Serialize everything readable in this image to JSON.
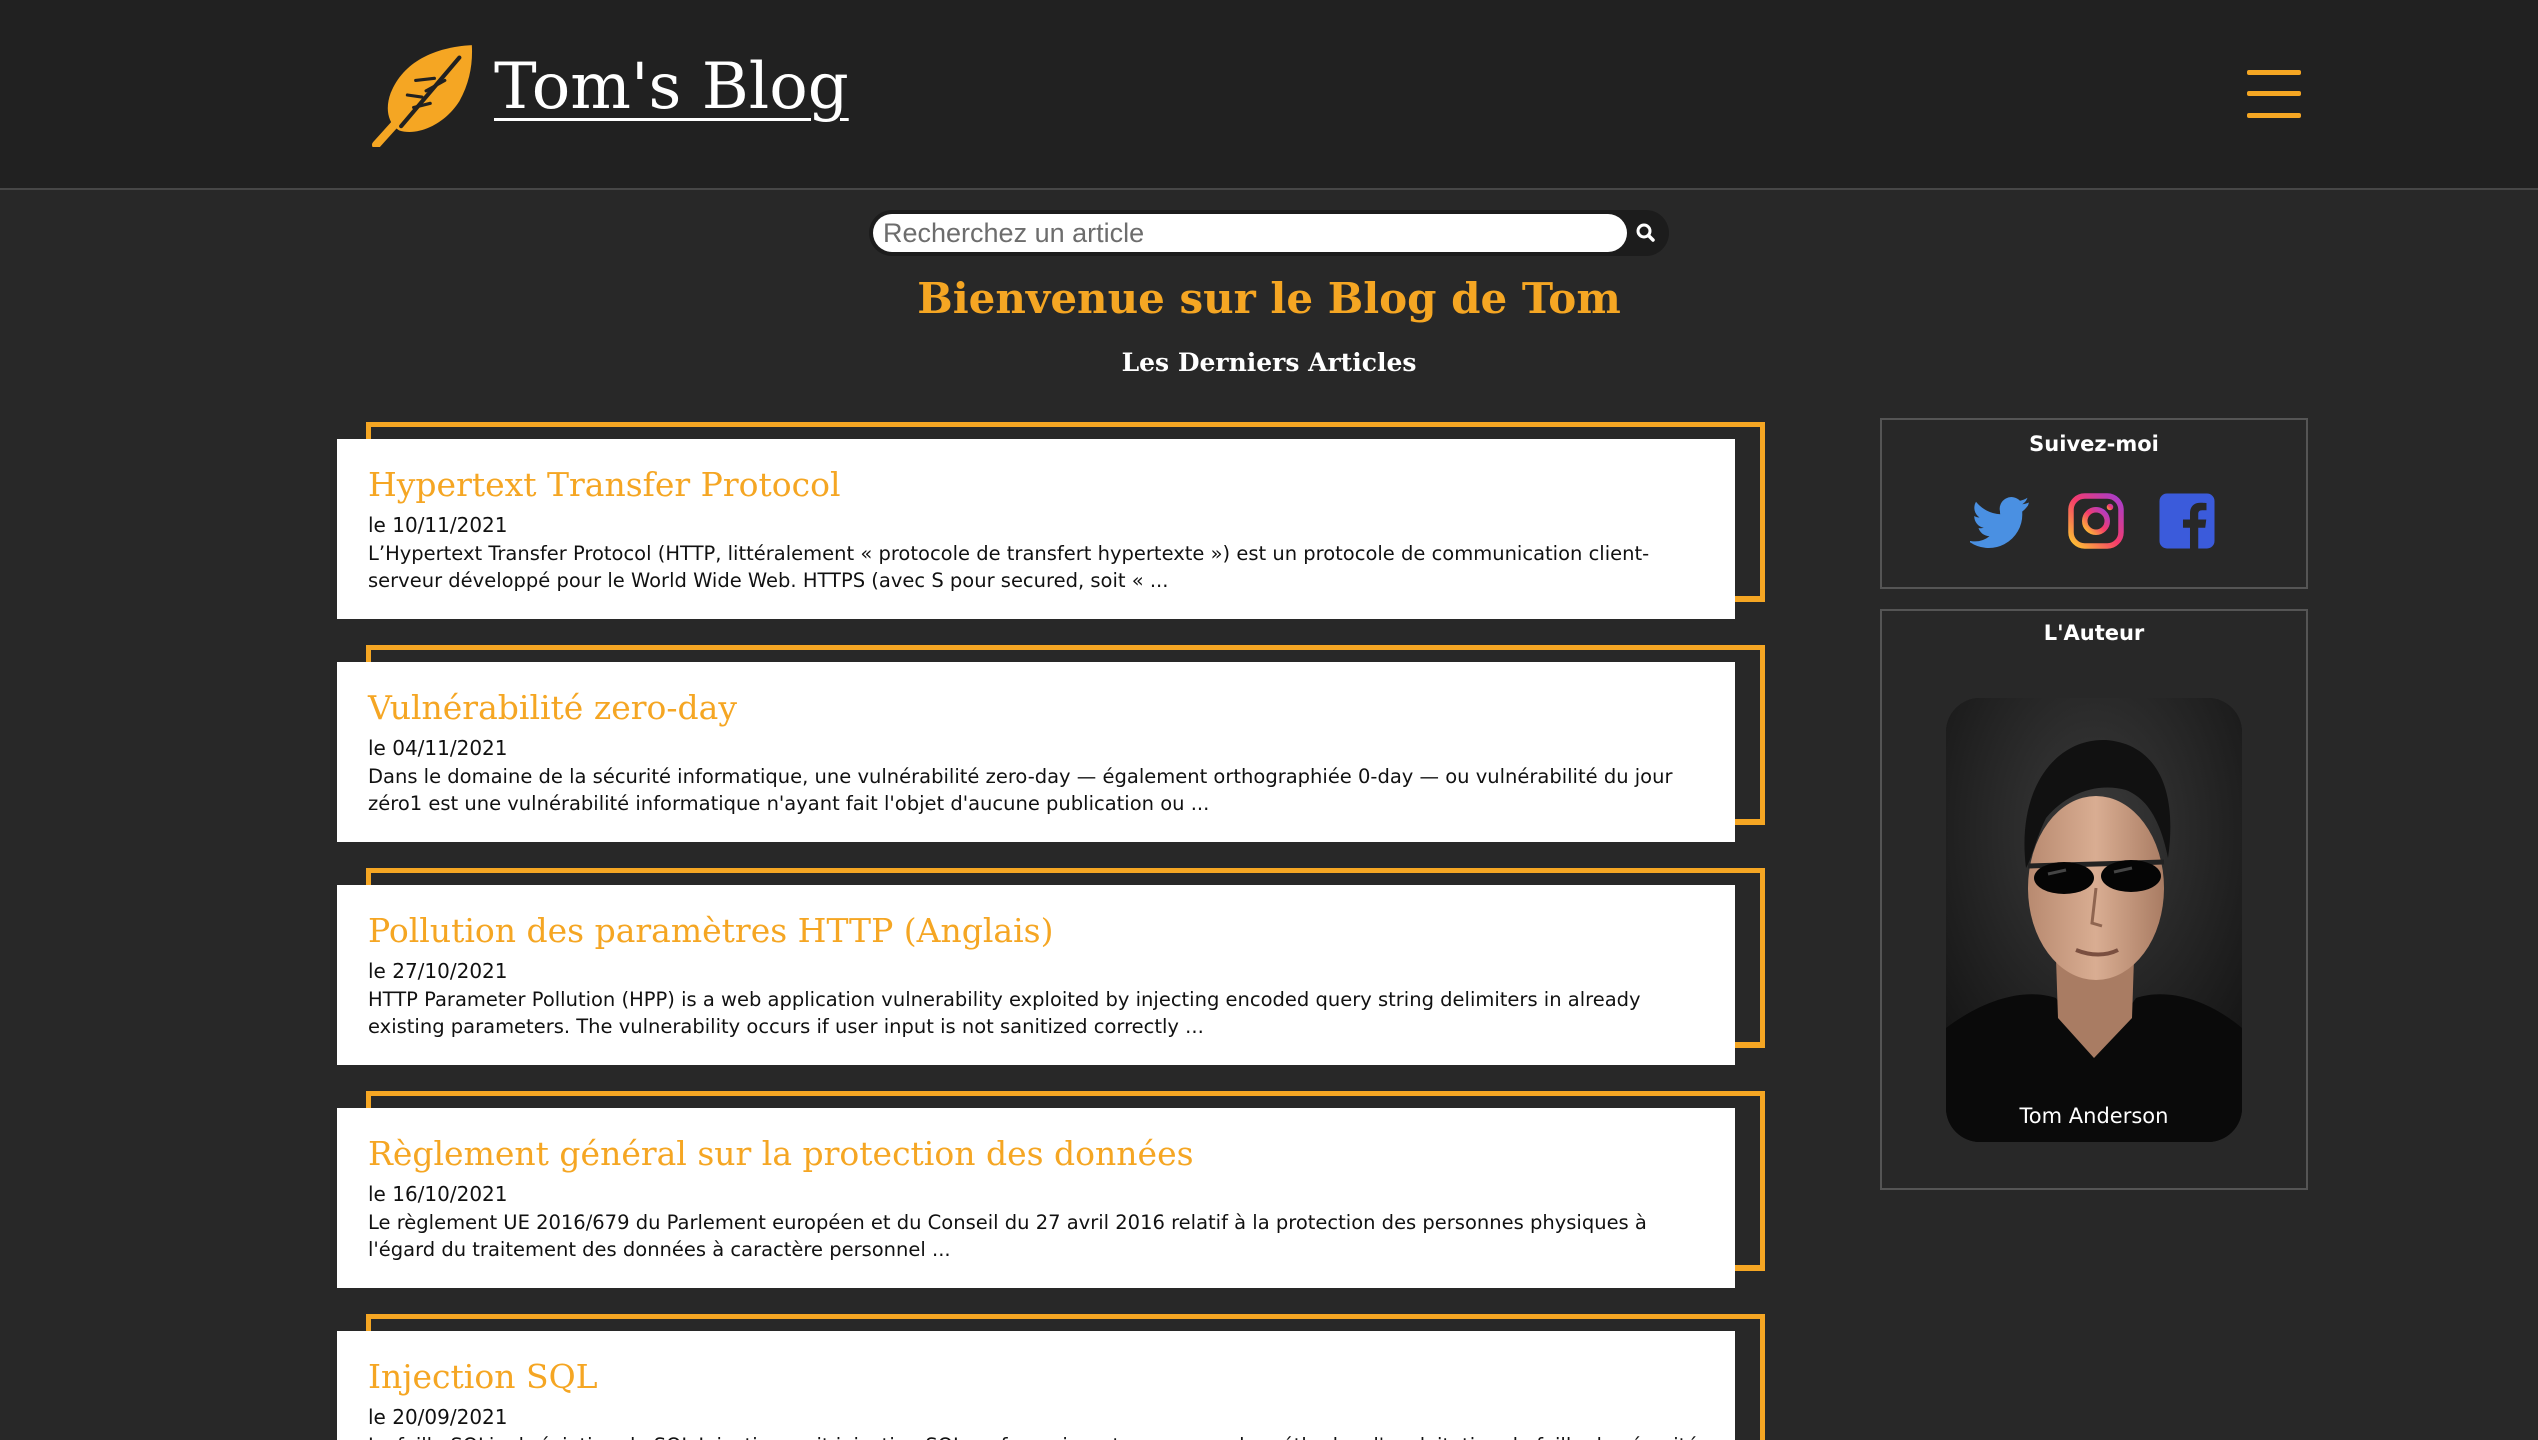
{
  "header": {
    "site_title": "Tom's Blog",
    "logo_icon": "feather-icon",
    "menu_icon": "hamburger-menu-icon",
    "accent_color": "#f5a623"
  },
  "search": {
    "placeholder": "Recherchez un article",
    "value": "",
    "button_icon": "search-icon"
  },
  "main": {
    "welcome": "Bienvenue sur le Blog de Tom",
    "latest_heading": "Les Derniers Articles",
    "articles": [
      {
        "title": "Hypertext Transfer Protocol",
        "date": "le 10/11/2021",
        "excerpt": "L’Hypertext Transfer Protocol (HTTP, littéralement « protocole de transfert hypertexte ») est un protocole de communication client-serveur développé pour le World Wide Web. HTTPS (avec S pour secured, soit « ..."
      },
      {
        "title": "Vulnérabilité zero-day",
        "date": "le 04/11/2021",
        "excerpt": "Dans le domaine de la sécurité informatique, une vulnérabilité zero-day — également orthographiée 0-day — ou vulnérabilité du jour zéro1 est une vulnérabilité informatique n'ayant fait l'objet d'aucune publication ou ..."
      },
      {
        "title": "Pollution des paramètres HTTP (Anglais)",
        "date": "le 27/10/2021",
        "excerpt": "HTTP Parameter Pollution (HPP) is a web application vulnerability exploited by injecting encoded query string delimiters in already existing parameters. The vulnerability occurs if user input is not sanitized correctly ..."
      },
      {
        "title": "Règlement général sur la protection des données",
        "date": "le 16/10/2021",
        "excerpt": "Le règlement UE 2016/679 du Parlement européen et du Conseil du 27 avril 2016 relatif à la protection des personnes physiques à l'égard du traitement des données à caractère personnel ..."
      },
      {
        "title": "Injection SQL",
        "date": "le 20/09/2021",
        "excerpt": "La faille SQLi, abréviation de SQL Injection, soit injection SQL en français, est un groupe de méthodes d'exploitation de faille de sécurité d'une"
      }
    ]
  },
  "sidebar": {
    "follow_title": "Suivez-moi",
    "social_icons": [
      "twitter-icon",
      "instagram-icon",
      "facebook-icon"
    ],
    "author_title": "L'Auteur",
    "author_name": "Tom Anderson",
    "author_photo": "author-portrait"
  }
}
